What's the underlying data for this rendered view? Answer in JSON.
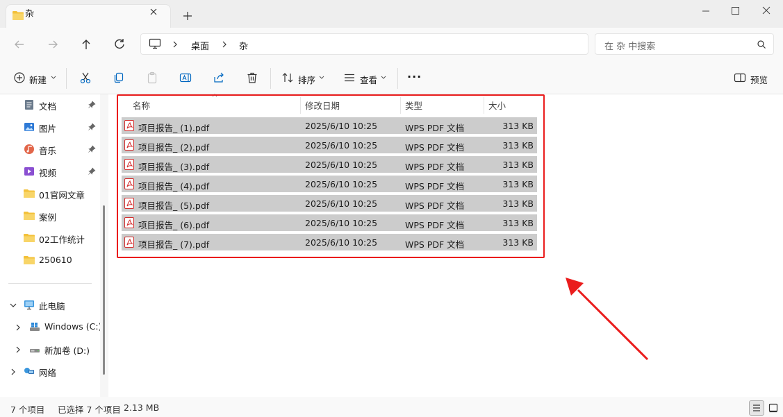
{
  "colors": {
    "accent": "#0067c0",
    "folder": "#f3c13a",
    "highlight_box": "#ea1c1c",
    "selection_row": "#cccccc",
    "pdf_red": "#d32f2f"
  },
  "window": {
    "tab_title": "杂",
    "tab_icon": "folder-icon",
    "add_tab": "+",
    "controls": [
      "minimize-icon",
      "maximize-icon",
      "close-icon"
    ]
  },
  "address": {
    "breadcrumb": [
      "桌面",
      "杂"
    ],
    "search_placeholder": "在 杂 中搜索"
  },
  "toolbar": {
    "new_label": "新建",
    "sort_label": "排序",
    "view_label": "查看",
    "more_label": "···",
    "preview_label": "预览"
  },
  "sidebar": {
    "quick": [
      {
        "label": "文档",
        "icon": "document-icon",
        "pinned": true
      },
      {
        "label": "图片",
        "icon": "pictures-icon",
        "pinned": true
      },
      {
        "label": "音乐",
        "icon": "music-icon",
        "pinned": true
      },
      {
        "label": "视频",
        "icon": "video-icon",
        "pinned": true
      },
      {
        "label": "01官网文章",
        "icon": "folder-icon",
        "pinned": false
      },
      {
        "label": "案例",
        "icon": "folder-icon",
        "pinned": false
      },
      {
        "label": "02工作统计",
        "icon": "folder-icon",
        "pinned": false
      },
      {
        "label": "250610",
        "icon": "folder-icon",
        "pinned": false
      }
    ],
    "this_pc": "此电脑",
    "drives": [
      "Windows (C:)",
      "新加卷 (D:)"
    ],
    "network": "网络"
  },
  "file_list": {
    "columns": [
      "名称",
      "修改日期",
      "类型",
      "大小"
    ],
    "rows": [
      {
        "name": "项目报告_ (1).pdf",
        "date": "2025/6/10 10:25",
        "type": "WPS PDF 文档",
        "size": "313 KB"
      },
      {
        "name": "项目报告_ (2).pdf",
        "date": "2025/6/10 10:25",
        "type": "WPS PDF 文档",
        "size": "313 KB"
      },
      {
        "name": "项目报告_ (3).pdf",
        "date": "2025/6/10 10:25",
        "type": "WPS PDF 文档",
        "size": "313 KB"
      },
      {
        "name": "项目报告_ (4).pdf",
        "date": "2025/6/10 10:25",
        "type": "WPS PDF 文档",
        "size": "313 KB"
      },
      {
        "name": "项目报告_ (5).pdf",
        "date": "2025/6/10 10:25",
        "type": "WPS PDF 文档",
        "size": "313 KB"
      },
      {
        "name": "项目报告_ (6).pdf",
        "date": "2025/6/10 10:25",
        "type": "WPS PDF 文档",
        "size": "313 KB"
      },
      {
        "name": "项目报告_ (7).pdf",
        "date": "2025/6/10 10:25",
        "type": "WPS PDF 文档",
        "size": "313 KB"
      }
    ]
  },
  "status": {
    "count": "7 个项目",
    "selection": "已选择 7 个项目",
    "size": "2.13 MB"
  }
}
